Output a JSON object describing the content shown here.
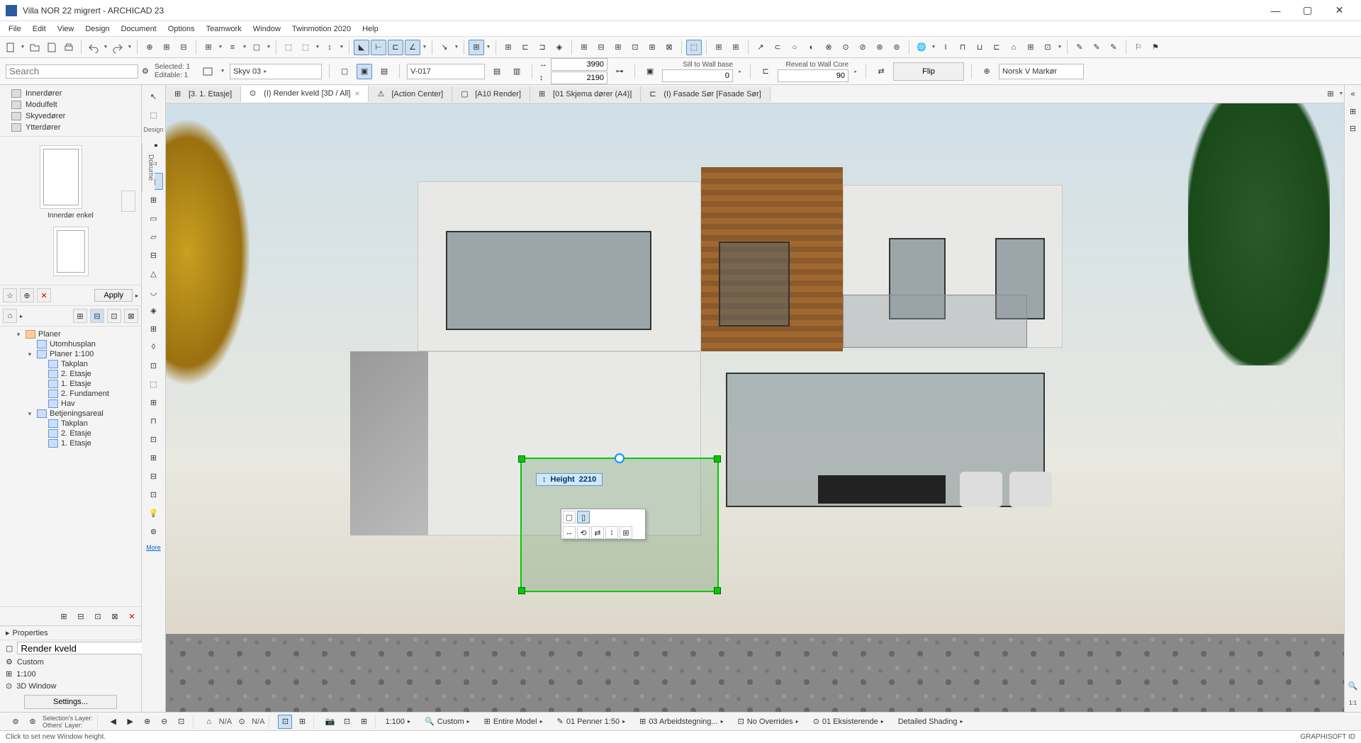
{
  "app": {
    "title": "Villa NOR 22 migrert - ARCHICAD 23",
    "icon": "archicad"
  },
  "window_controls": {
    "min": "—",
    "max": "▢",
    "close": "✕"
  },
  "menu": [
    "File",
    "Edit",
    "View",
    "Design",
    "Document",
    "Options",
    "Teamwork",
    "Window",
    "Twinmotion 2020",
    "Help"
  ],
  "search": {
    "placeholder": "Search"
  },
  "selection": {
    "line1": "Selected: 1",
    "line2": "Editable: 1"
  },
  "infobar": {
    "element_combo": "Skyv 03",
    "id_value": "V-017",
    "width": "3990",
    "height": "2190",
    "sill_label": "Sill to Wall base",
    "sill_value": "0",
    "reveal_label": "Reveal to Wall Core",
    "reveal_value": "90",
    "flip": "Flip",
    "marker": "Norsk V Markør"
  },
  "left_folders": [
    "Innerdører",
    "Modulfelt",
    "Skyvedører",
    "Ytterdører"
  ],
  "preview": {
    "label": "Innerdør enkel"
  },
  "apply_btn": "Apply",
  "navigator": {
    "root": "Planer",
    "items": [
      {
        "label": "Utomhusplan",
        "indent": 2
      },
      {
        "label": "Planer 1:100",
        "indent": 2,
        "expandable": true,
        "expanded": true
      },
      {
        "label": "Takplan",
        "indent": 3
      },
      {
        "label": "2. Etasje",
        "indent": 3
      },
      {
        "label": "1. Etasje",
        "indent": 3
      },
      {
        "label": "2. Fundament",
        "indent": 3
      },
      {
        "label": "Hav",
        "indent": 3
      },
      {
        "label": "Betjeningsareal",
        "indent": 2,
        "expandable": true,
        "expanded": true
      },
      {
        "label": "Takplan",
        "indent": 3
      },
      {
        "label": "2. Etasje",
        "indent": 3
      },
      {
        "label": "1. Etasje",
        "indent": 3
      }
    ]
  },
  "properties": {
    "header": "Properties",
    "name_value": "Render kveld",
    "custom": "Custom",
    "scale": "1:100",
    "view_type": "3D Window",
    "settings": "Settings..."
  },
  "tool_palette": {
    "design_label": "Design",
    "more": "More"
  },
  "tabs": [
    {
      "label": "[3. 1. Etasje]",
      "icon": "plan"
    },
    {
      "label": "(I) Render kveld [3D / All]",
      "icon": "3d",
      "active": true,
      "closable": true
    },
    {
      "label": "[Action Center]",
      "icon": "action"
    },
    {
      "label": "[A10 Render]",
      "icon": "layout"
    },
    {
      "label": "[01 Skjema dører (A4)]",
      "icon": "schedule"
    },
    {
      "label": "(I) Fasade Sør [Fasade Sør]",
      "icon": "elevation"
    }
  ],
  "dokume_tab": "Dokume",
  "selected_window": {
    "param_label": "Height",
    "param_value": "2210"
  },
  "quickbar": {
    "layer_sel_label": "Selection's Layer:",
    "layer_oth_label": "Others' Layer:",
    "na1": "N/A",
    "na2": "N/A",
    "scale": "1:100",
    "zoom": "Custom",
    "model": "Entire Model",
    "pen": "01 Penner 1:50",
    "renovation": "03 Arbeidstegning...",
    "overrides": "No Overrides",
    "status": "01 Eksisterende",
    "shading": "Detailed Shading"
  },
  "status": {
    "hint": "Click to set new Window height.",
    "brand": "GRAPHISOFT ID"
  }
}
